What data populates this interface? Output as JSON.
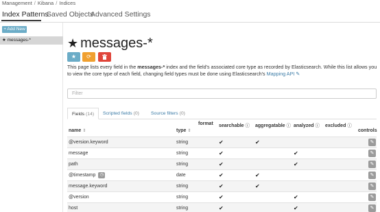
{
  "breadcrumb": [
    "Management",
    "Kibana",
    "Indices"
  ],
  "breadcrumb_sep": "/",
  "topnav": {
    "tabs": [
      "Index Patterns",
      "Saved Objects",
      "Advanced Settings"
    ]
  },
  "sidebar": {
    "add_button": "+ Add New",
    "selected_pattern": "★ messages-*"
  },
  "page": {
    "title": "messages-*",
    "title_icon": "★",
    "description_1": "This page lists every field in the ",
    "description_bold": "messages-*",
    "description_2": " index and the field's associated core type as recorded by Elasticsearch. While this list allows you to view the core type of each field, changing field types must be done using Elasticsearch's ",
    "description_link": "Mapping API"
  },
  "filter": {
    "placeholder": "Filter"
  },
  "subtabs": [
    {
      "label": "Fields",
      "count": "(14)"
    },
    {
      "label": "Scripted fields",
      "count": "(0)"
    },
    {
      "label": "Source filters",
      "count": "(0)"
    }
  ],
  "table": {
    "headers": {
      "name": "name",
      "type": "type",
      "format": "format",
      "searchable": "searchable",
      "aggregatable": "aggregatable",
      "analyzed": "analyzed",
      "excluded": "excluded",
      "controls": "controls"
    },
    "check_glyph": "✔",
    "rows": [
      {
        "name": "@version.keyword",
        "type": "string",
        "searchable": true,
        "aggregatable": true,
        "analyzed": false
      },
      {
        "name": "message",
        "type": "string",
        "searchable": true,
        "aggregatable": false,
        "analyzed": true
      },
      {
        "name": "path",
        "type": "string",
        "searchable": true,
        "aggregatable": false,
        "analyzed": true
      },
      {
        "name": "@timestamp",
        "type": "date",
        "searchable": true,
        "aggregatable": true,
        "analyzed": false,
        "badge": true
      },
      {
        "name": "message.keyword",
        "type": "string",
        "searchable": true,
        "aggregatable": true,
        "analyzed": false
      },
      {
        "name": "@version",
        "type": "string",
        "searchable": true,
        "aggregatable": false,
        "analyzed": true
      },
      {
        "name": "host",
        "type": "string",
        "searchable": true,
        "aggregatable": false,
        "analyzed": true
      }
    ]
  },
  "colors": {
    "primary": "#6bacc7",
    "warning": "#f0a030",
    "danger": "#e0453a",
    "link": "#3b7ba6"
  },
  "icons": {
    "star": "star-icon",
    "refresh": "refresh-icon",
    "delete": "trash-icon",
    "edit": "pencil-icon",
    "info": "info-icon",
    "sort": "sort-icon",
    "clock": "clock-icon"
  }
}
